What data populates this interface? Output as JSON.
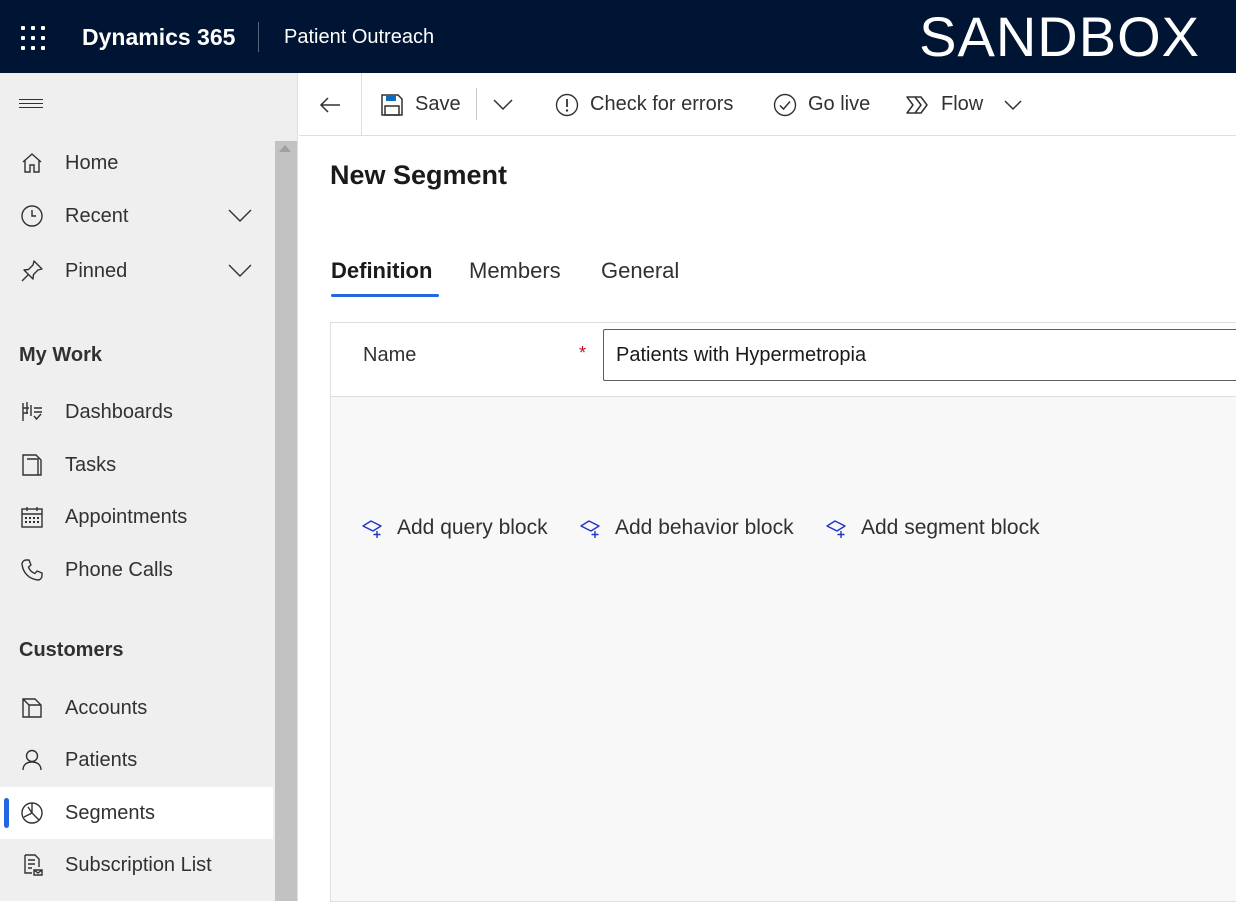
{
  "header": {
    "app_name": "Dynamics 365",
    "module_name": "Patient Outreach",
    "environment": "SANDBOX"
  },
  "sidebar": {
    "top_items": [
      {
        "label": "Home",
        "icon": "home-icon"
      },
      {
        "label": "Recent",
        "icon": "clock-icon"
      },
      {
        "label": "Pinned",
        "icon": "pin-icon"
      }
    ],
    "groups": [
      {
        "title": "My Work",
        "items": [
          {
            "label": "Dashboards",
            "icon": "dashboard-icon"
          },
          {
            "label": "Tasks",
            "icon": "tasks-icon"
          },
          {
            "label": "Appointments",
            "icon": "calendar-icon"
          },
          {
            "label": "Phone Calls",
            "icon": "phone-icon"
          }
        ]
      },
      {
        "title": "Customers",
        "items": [
          {
            "label": "Accounts",
            "icon": "accounts-icon"
          },
          {
            "label": "Patients",
            "icon": "person-icon"
          },
          {
            "label": "Segments",
            "icon": "segments-icon",
            "selected": true
          },
          {
            "label": "Subscription List",
            "icon": "subscription-list-icon"
          }
        ]
      }
    ]
  },
  "commands": {
    "save": "Save",
    "check_errors": "Check for errors",
    "go_live": "Go live",
    "flow": "Flow"
  },
  "page": {
    "title": "New Segment",
    "tabs": [
      "Definition",
      "Members",
      "General"
    ],
    "active_tab": "Definition"
  },
  "form": {
    "name_label": "Name",
    "required_marker": "*",
    "name_value": "Patients with Hypermetropia"
  },
  "blocks": {
    "query": "Add query block",
    "behavior": "Add behavior block",
    "segment": "Add segment block"
  },
  "colors": {
    "topbar": "#001533",
    "accent": "#2266e3",
    "block_icon": "#2133c8"
  }
}
